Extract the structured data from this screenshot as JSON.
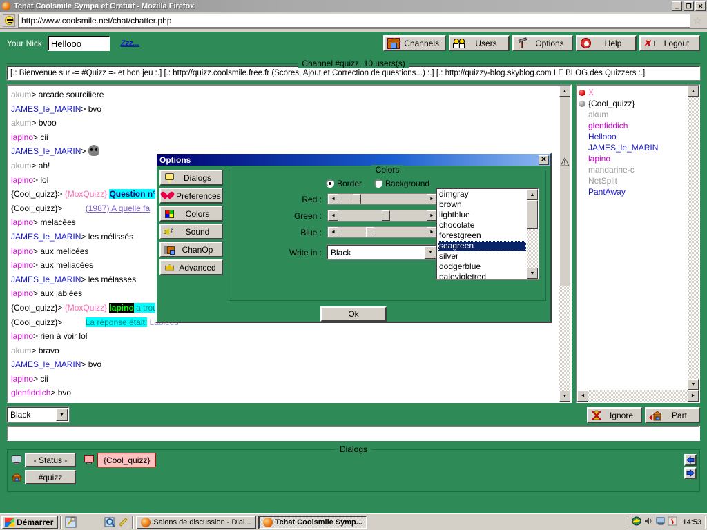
{
  "browser": {
    "title": "Tchat Coolsmile Sympa et Gratuit - Mozilla Firefox",
    "url": "http://www.coolsmile.net/chat/chatter.php",
    "minimize_label": "_",
    "restore_label": "❐",
    "close_label": "✕",
    "bookmark_star": "☆"
  },
  "chat": {
    "nick_label": "Your Nick",
    "nick_value": "Hellooo",
    "away_link": "Zzz...",
    "toolbar": [
      {
        "label": "Channels",
        "icon": "house-icon"
      },
      {
        "label": "Users",
        "icon": "users-icon"
      },
      {
        "label": "Options",
        "icon": "hammer-icon"
      },
      {
        "label": "Help",
        "icon": "lifering-icon"
      },
      {
        "label": "Logout",
        "icon": "plug-disconnect-icon"
      }
    ],
    "channel_caption": "Channel #quizz, 10 users(s)",
    "topic": "[.: Bienvenue sur -= #Quizz =- et bon jeu :.] [.:  http://quizz.coolsmile.free.fr (Scores, Ajout et Correction de questions...) :.] [.: http://quizzy-blog.skyblog.com LE BLOG des Quizzers :.]",
    "messages": [
      {
        "nick": "akum",
        "nick_class": "nk-grey",
        "text": " arcade sourciliere"
      },
      {
        "nick": "JAMES_le_MARIN",
        "nick_class": "nk-blue",
        "text": " bvo"
      },
      {
        "nick": "akum",
        "nick_class": "nk-grey",
        "text": " bvoo"
      },
      {
        "nick": "lapino",
        "nick_class": "nk-magenta",
        "text": " cii"
      },
      {
        "nick": "JAMES_le_MARIN",
        "nick_class": "nk-blue",
        "text": " ",
        "skull": true
      },
      {
        "nick": "akum",
        "nick_class": "nk-grey",
        "text": " ah!"
      },
      {
        "nick": "lapino",
        "nick_class": "nk-magenta",
        "text": " lol"
      },
      {
        "nick": "{Cool_quizz}",
        "nick_class": "nk-black",
        "bot": " {MoxQuizz} ",
        "hl_cyan": "Question n° ",
        "text": ""
      },
      {
        "nick": "{Cool_quizz}",
        "nick_class": "nk-black",
        "indent": true,
        "link": "(1987) A quelle fa"
      },
      {
        "nick": "lapino",
        "nick_class": "nk-magenta",
        "text": " melacées"
      },
      {
        "nick": "JAMES_le_MARIN",
        "nick_class": "nk-blue",
        "text": " les mélissés"
      },
      {
        "nick": "lapino",
        "nick_class": "nk-magenta",
        "text": " aux melicées"
      },
      {
        "nick": "lapino",
        "nick_class": "nk-magenta",
        "text": " aux meliacées"
      },
      {
        "nick": "JAMES_le_MARIN",
        "nick_class": "nk-blue",
        "text": " les mélasses"
      },
      {
        "nick": "lapino",
        "nick_class": "nk-magenta",
        "text": " aux labiées"
      },
      {
        "nick": "{Cool_quizz}",
        "nick_class": "nk-black",
        "bot": " {MoxQuizz} ",
        "hl_black": "lapino",
        "hl_cyan2": " a trouv",
        "text": ""
      },
      {
        "nick": "{Cool_quizz}",
        "nick_class": "nk-black",
        "indent2": true,
        "hl_cyan2": "La réponse était:",
        "lav": " Labiées"
      },
      {
        "nick": "lapino",
        "nick_class": "nk-magenta",
        "text": " rien à voir lol"
      },
      {
        "nick": "akum",
        "nick_class": "nk-grey",
        "text": " bravo"
      },
      {
        "nick": "JAMES_le_MARIN",
        "nick_class": "nk-blue",
        "text": " bvo"
      },
      {
        "nick": "lapino",
        "nick_class": "nk-magenta",
        "text": " cii"
      },
      {
        "nick": "glenfiddich",
        "nick_class": "nk-magenta",
        "text": " bvo"
      }
    ],
    "users": [
      {
        "label": "X",
        "icon": "globe-red-icon",
        "class": "nk-pink",
        "indent": false
      },
      {
        "label": "{Cool_quizz}",
        "icon": "globe-grey-icon",
        "class": "nk-black",
        "indent": false
      },
      {
        "label": "akum",
        "class": "nk-grey",
        "indent": true
      },
      {
        "label": "glenfiddich",
        "class": "nk-magenta",
        "indent": true
      },
      {
        "label": "Hellooo",
        "class": "nk-blue",
        "indent": true
      },
      {
        "label": "JAMES_le_MARIN",
        "class": "nk-blue",
        "indent": true
      },
      {
        "label": "lapino",
        "class": "nk-magenta",
        "indent": true
      },
      {
        "label": "mandarine-c",
        "class": "nk-grey",
        "indent": true
      },
      {
        "label": "NetSplit",
        "class": "nk-grey",
        "indent": true
      },
      {
        "label": "PantAway",
        "class": "nk-blue",
        "indent": true
      }
    ],
    "color_select": "Black",
    "ignore_label": "Ignore",
    "part_label": "Part",
    "message_input": "",
    "dialogs_caption": "Dialogs",
    "dialogs": [
      {
        "label": "- Status -",
        "icon": "monitor-icon",
        "active": false
      },
      {
        "label": "{Cool_quizz}",
        "icon": "monitor-red-icon",
        "active": true
      },
      {
        "label": "#quizz",
        "icon": "house-icon",
        "active": false
      }
    ],
    "scroll_up": "▲",
    "scroll_down": "▼",
    "scroll_left": "◄",
    "scroll_right": "►"
  },
  "options_dialog": {
    "title": "Options",
    "close_label": "✕",
    "sidebar": [
      {
        "label": "Dialogs",
        "icon": "speech-bubble-icon"
      },
      {
        "label": "Preferences",
        "icon": "heart-icon"
      },
      {
        "label": "Colors",
        "icon": "palette-icon"
      },
      {
        "label": "Sound",
        "icon": "speaker-note-icon"
      },
      {
        "label": "ChanOp",
        "icon": "chanop-house-icon"
      },
      {
        "label": "Advanced",
        "icon": "crown-icon"
      }
    ],
    "panel_caption": "Colors",
    "radios": [
      {
        "label": "Border",
        "selected": true
      },
      {
        "label": "Background",
        "selected": false
      }
    ],
    "sliders": [
      {
        "label": "Red :",
        "value": 46,
        "max": 255
      },
      {
        "label": "Green :",
        "value": 139,
        "max": 255
      },
      {
        "label": "Blue :",
        "value": 87,
        "max": 255
      }
    ],
    "write_in_label": "Write in :",
    "write_in_value": "Black",
    "color_list": [
      "dimgray",
      "brown",
      "lightblue",
      "chocolate",
      "forestgreen",
      "seagreen",
      "silver",
      "dodgerblue",
      "palevioletred"
    ],
    "color_selected": "seagreen",
    "ok_label": "Ok"
  },
  "taskbar": {
    "start_label": "Démarrer",
    "quick_icons": [
      "show-desktop-icon",
      "firefox-icon",
      "internet-explorer-icon",
      "search-icon",
      "media-icon"
    ],
    "tasks": [
      {
        "label": "Salons de discussion - Dial...",
        "active": false
      },
      {
        "label": "Tchat Coolsmile Symp...",
        "active": true
      }
    ],
    "tray_icons": [
      "network-icon",
      "volume-icon",
      "display-icon",
      "java-icon"
    ],
    "clock": "14:53"
  }
}
